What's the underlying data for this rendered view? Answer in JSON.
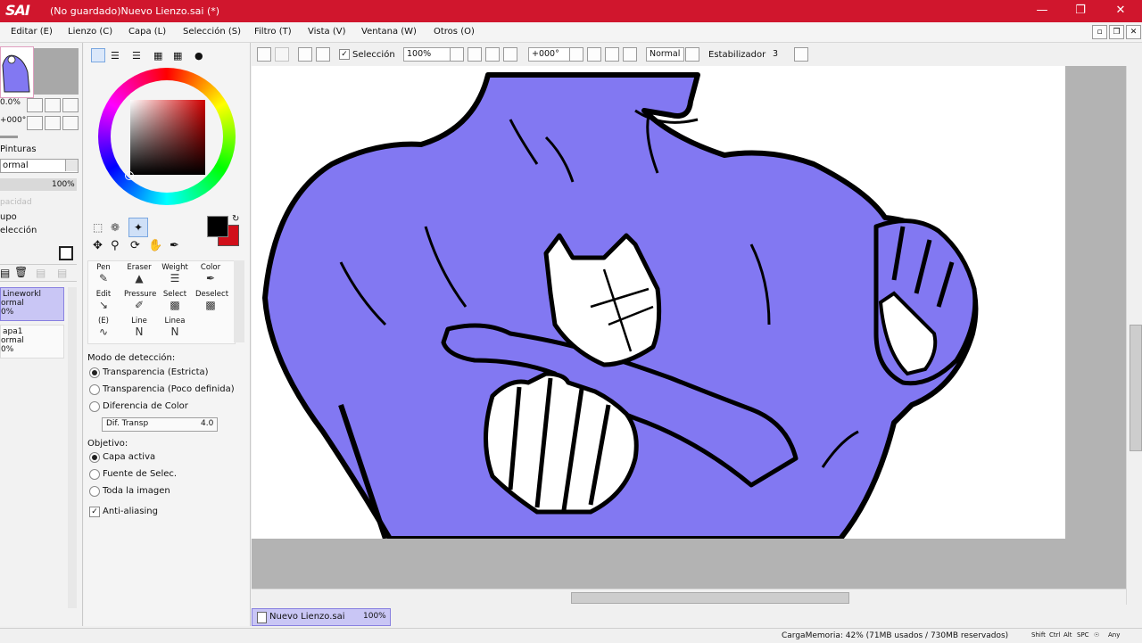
{
  "window": {
    "logo": "SAI",
    "title": "(No guardado)Nuevo Lienzo.sai (*)"
  },
  "menu": [
    "Editar (E)",
    "Lienzo (C)",
    "Capa (L)",
    "Selección (S)",
    "Filtro (T)",
    "Vista (V)",
    "Ventana (W)",
    "Otros (O)"
  ],
  "navigator": {
    "zoom": "0.0%",
    "angle": "+000°"
  },
  "layers_panel": {
    "pinturas_label": "Pinturas",
    "blend_mode": "ormal",
    "opacity": "100%",
    "opacidad_label": "pacidad",
    "grupo_label": "upo",
    "seleccion_label": "elección",
    "layers": [
      {
        "name": "Lineworkl",
        "mode": "ormal",
        "opacity": "0%"
      },
      {
        "name": "apa1",
        "mode": "ormal",
        "opacity": "0%"
      }
    ]
  },
  "tools": {
    "cells": [
      {
        "label": "Pen",
        "icon": "pen-icon"
      },
      {
        "label": "Eraser",
        "icon": "eraser-icon"
      },
      {
        "label": "Weight",
        "icon": "weight-icon"
      },
      {
        "label": "Color",
        "icon": "color-pick-icon"
      },
      {
        "label": "Edit",
        "icon": "edit-arrow-icon"
      },
      {
        "label": "Pressure",
        "icon": "pressure-icon"
      },
      {
        "label": "Select",
        "icon": "select-brush-icon"
      },
      {
        "label": "Deselect",
        "icon": "deselect-brush-icon"
      },
      {
        "label": "(E)",
        "icon": "curve-icon"
      },
      {
        "label": "Line",
        "icon": "line-icon"
      },
      {
        "label": "Linea",
        "icon": "line2-icon"
      }
    ]
  },
  "detection": {
    "heading": "Modo de detección:",
    "options": [
      "Transparencia (Estricta)",
      "Transparencia (Poco definida)",
      "Diferencia de Color"
    ],
    "selected": 0,
    "diff_label": "Dif. Transp",
    "diff_value": "4.0",
    "target_heading": "Objetivo:",
    "target_options": [
      "Capa activa",
      "Fuente de Selec.",
      "Toda la imagen"
    ],
    "target_selected": 0,
    "antialias_label": "Anti-aliasing"
  },
  "toolbar": {
    "selection_label": "Selección",
    "zoom_value": "100%",
    "angle_value": "+000°",
    "blend_value": "Normal",
    "stabilizer_label": "Estabilizador",
    "stabilizer_value": "3"
  },
  "document_tab": {
    "name": "Nuevo Lienzo.sai",
    "zoom": "100%"
  },
  "status": {
    "memory": "CargaMemoria: 42% (71MB usados / 730MB reservados)",
    "keys": [
      "Shift",
      "Ctrl",
      "Alt",
      "SPC",
      "☉",
      "Any"
    ]
  },
  "colors": {
    "title_bar": "#d0162d",
    "figure_fill": "#8278f2",
    "primary_color": "#000000",
    "secondary_color": "#d10f1a"
  }
}
